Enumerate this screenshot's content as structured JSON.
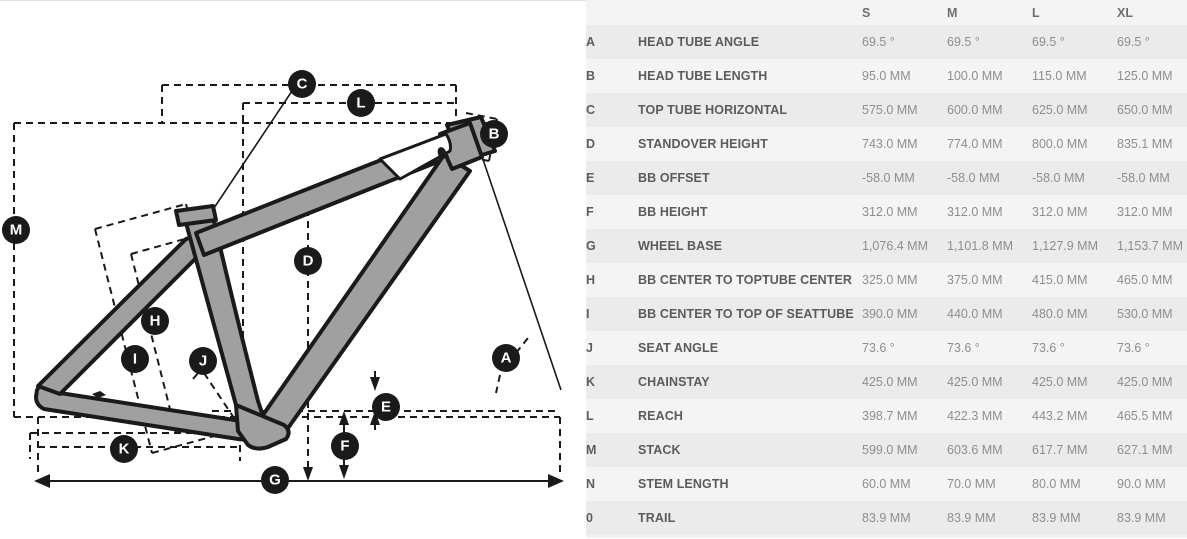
{
  "diagram": {
    "title": "bike-frame-geometry-diagram",
    "callouts": [
      {
        "id": "A",
        "label": "A"
      },
      {
        "id": "B",
        "label": "B"
      },
      {
        "id": "C",
        "label": "C"
      },
      {
        "id": "D",
        "label": "D"
      },
      {
        "id": "E",
        "label": "E"
      },
      {
        "id": "F",
        "label": "F"
      },
      {
        "id": "G",
        "label": "G"
      },
      {
        "id": "H",
        "label": "H"
      },
      {
        "id": "I",
        "label": "I"
      },
      {
        "id": "J",
        "label": "J"
      },
      {
        "id": "K",
        "label": "K"
      },
      {
        "id": "L",
        "label": "L"
      },
      {
        "id": "M",
        "label": "M"
      }
    ]
  },
  "table": {
    "columns": [
      "",
      "",
      "S",
      "M",
      "L",
      "XL"
    ],
    "headers": {
      "key": "",
      "label": "",
      "s": "S",
      "m": "M",
      "l": "L",
      "xl": "XL"
    },
    "rows": [
      {
        "key": "A",
        "label": "HEAD TUBE ANGLE",
        "s": "69.5 °",
        "m": "69.5 °",
        "l": "69.5 °",
        "xl": "69.5 °"
      },
      {
        "key": "B",
        "label": "HEAD TUBE LENGTH",
        "s": "95.0 MM",
        "m": "100.0 MM",
        "l": "115.0 MM",
        "xl": "125.0 MM"
      },
      {
        "key": "C",
        "label": "TOP TUBE HORIZONTAL",
        "s": "575.0 MM",
        "m": "600.0 MM",
        "l": "625.0 MM",
        "xl": "650.0 MM"
      },
      {
        "key": "D",
        "label": "STANDOVER HEIGHT",
        "s": "743.0 MM",
        "m": "774.0 MM",
        "l": "800.0 MM",
        "xl": "835.1 MM"
      },
      {
        "key": "E",
        "label": "BB OFFSET",
        "s": "-58.0 MM",
        "m": "-58.0 MM",
        "l": "-58.0 MM",
        "xl": "-58.0 MM"
      },
      {
        "key": "F",
        "label": "BB HEIGHT",
        "s": "312.0 MM",
        "m": "312.0 MM",
        "l": "312.0 MM",
        "xl": "312.0 MM"
      },
      {
        "key": "G",
        "label": "WHEEL BASE",
        "s": "1,076.4 MM",
        "m": "1,101.8 MM",
        "l": "1,127.9 MM",
        "xl": "1,153.7 MM"
      },
      {
        "key": "H",
        "label": "BB CENTER TO TOPTUBE CENTER",
        "s": "325.0 MM",
        "m": "375.0 MM",
        "l": "415.0 MM",
        "xl": "465.0 MM"
      },
      {
        "key": "I",
        "label": "BB CENTER TO TOP OF SEATTUBE",
        "s": "390.0 MM",
        "m": "440.0 MM",
        "l": "480.0 MM",
        "xl": "530.0 MM"
      },
      {
        "key": "J",
        "label": "SEAT ANGLE",
        "s": "73.6 °",
        "m": "73.6 °",
        "l": "73.6 °",
        "xl": "73.6 °"
      },
      {
        "key": "K",
        "label": "CHAINSTAY",
        "s": "425.0 MM",
        "m": "425.0 MM",
        "l": "425.0 MM",
        "xl": "425.0 MM"
      },
      {
        "key": "L",
        "label": "REACH",
        "s": "398.7 MM",
        "m": "422.3 MM",
        "l": "443.2 MM",
        "xl": "465.5 MM"
      },
      {
        "key": "M",
        "label": "STACK",
        "s": "599.0 MM",
        "m": "603.6 MM",
        "l": "617.7 MM",
        "xl": "627.1 MM"
      },
      {
        "key": "N",
        "label": "STEM LENGTH",
        "s": "60.0 MM",
        "m": "70.0 MM",
        "l": "80.0 MM",
        "xl": "90.0 MM"
      },
      {
        "key": "0",
        "label": "TRAIL",
        "s": "83.9 MM",
        "m": "83.9 MM",
        "l": "83.9 MM",
        "xl": "83.9 MM"
      }
    ]
  },
  "colors": {
    "row_odd": "#ebebeb",
    "row_even": "#f4f4f4",
    "label_text": "#5b5b5b",
    "value_text": "#8e8e8e",
    "diagram_ink": "#1a1a1a",
    "frame_fill": "#a0a0a0"
  }
}
